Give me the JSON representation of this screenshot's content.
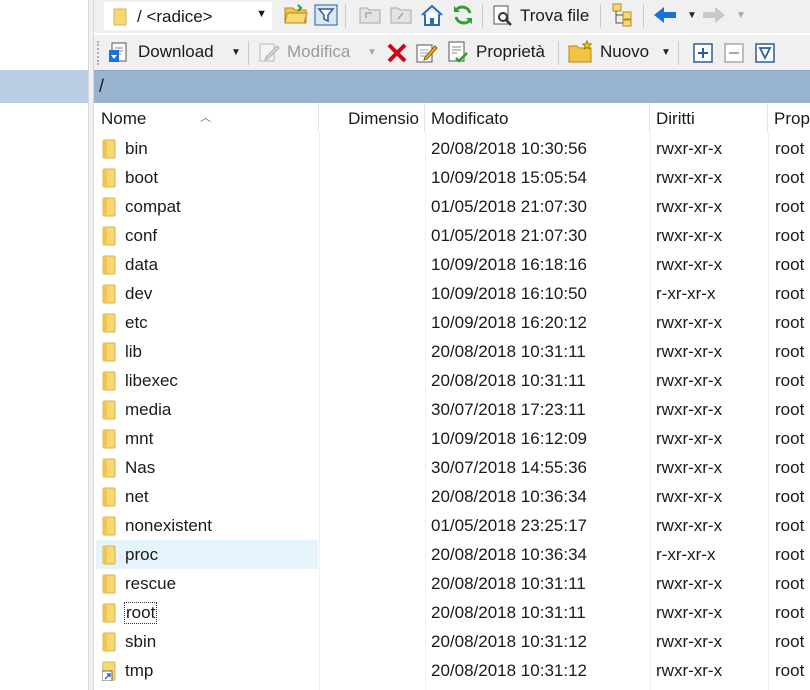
{
  "toolbar_top": {
    "path_value": "/ <radice>",
    "find_files_label": "Trova file"
  },
  "toolbar_bottom": {
    "download_label": "Download",
    "edit_label": "Modifica",
    "properties_label": "Proprietà",
    "new_label": "Nuovo"
  },
  "pathbar": {
    "path": "/"
  },
  "columns": {
    "name": "Nome",
    "size": "Dimensio",
    "modified": "Modificato",
    "rights": "Diritti",
    "owner": "Prop"
  },
  "files": [
    {
      "name": "bin",
      "modified": "20/08/2018 10:30:56",
      "rights": "rwxr-xr-x",
      "owner": "root"
    },
    {
      "name": "boot",
      "modified": "10/09/2018 15:05:54",
      "rights": "rwxr-xr-x",
      "owner": "root"
    },
    {
      "name": "compat",
      "modified": "01/05/2018 21:07:30",
      "rights": "rwxr-xr-x",
      "owner": "root"
    },
    {
      "name": "conf",
      "modified": "01/05/2018 21:07:30",
      "rights": "rwxr-xr-x",
      "owner": "root"
    },
    {
      "name": "data",
      "modified": "10/09/2018 16:18:16",
      "rights": "rwxr-xr-x",
      "owner": "root"
    },
    {
      "name": "dev",
      "modified": "10/09/2018 16:10:50",
      "rights": "r-xr-xr-x",
      "owner": "root"
    },
    {
      "name": "etc",
      "modified": "10/09/2018 16:20:12",
      "rights": "rwxr-xr-x",
      "owner": "root"
    },
    {
      "name": "lib",
      "modified": "20/08/2018 10:31:11",
      "rights": "rwxr-xr-x",
      "owner": "root"
    },
    {
      "name": "libexec",
      "modified": "20/08/2018 10:31:11",
      "rights": "rwxr-xr-x",
      "owner": "root"
    },
    {
      "name": "media",
      "modified": "30/07/2018 17:23:11",
      "rights": "rwxr-xr-x",
      "owner": "root"
    },
    {
      "name": "mnt",
      "modified": "10/09/2018 16:12:09",
      "rights": "rwxr-xr-x",
      "owner": "root"
    },
    {
      "name": "Nas",
      "modified": "30/07/2018 14:55:36",
      "rights": "rwxr-xr-x",
      "owner": "root"
    },
    {
      "name": "net",
      "modified": "20/08/2018 10:36:34",
      "rights": "rwxr-xr-x",
      "owner": "root"
    },
    {
      "name": "nonexistent",
      "modified": "01/05/2018 23:25:17",
      "rights": "rwxr-xr-x",
      "owner": "root"
    },
    {
      "name": "proc",
      "modified": "20/08/2018 10:36:34",
      "rights": "r-xr-xr-x",
      "owner": "root",
      "state": "hover"
    },
    {
      "name": "rescue",
      "modified": "20/08/2018 10:31:11",
      "rights": "rwxr-xr-x",
      "owner": "root"
    },
    {
      "name": "root",
      "modified": "20/08/2018 10:31:11",
      "rights": "rwxr-xr-x",
      "owner": "root",
      "state": "focused"
    },
    {
      "name": "sbin",
      "modified": "20/08/2018 10:31:12",
      "rights": "rwxr-xr-x",
      "owner": "root"
    },
    {
      "name": "tmp",
      "modified": "20/08/2018 10:31:12",
      "rights": "rwxr-xr-x",
      "owner": "root",
      "icon": "folder-link-icon"
    }
  ],
  "colors": {
    "pathbar_bg": "#99b4d1",
    "left_bar_bg": "#b8cce4",
    "hover_row_bg": "#e5f3fb",
    "folder_yellow": "#f8d775",
    "delete_red": "#d0021b",
    "nav_blue": "#1e6fd9"
  }
}
